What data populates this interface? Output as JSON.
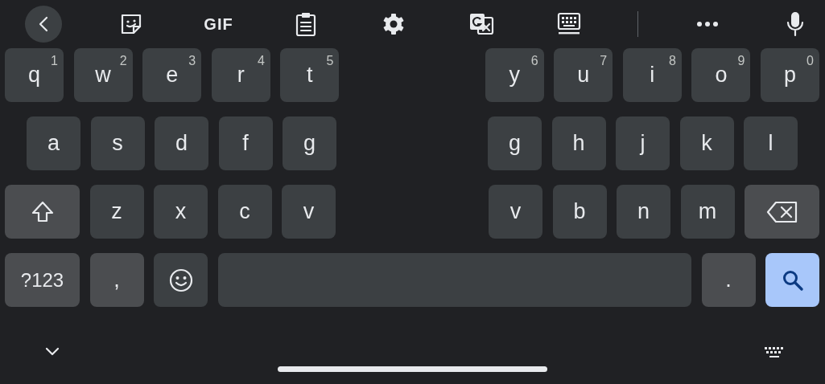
{
  "toolbar": [
    {
      "kind": "back"
    },
    {
      "kind": "sticker"
    },
    {
      "kind": "text",
      "label": "GIF"
    },
    {
      "kind": "clipboard"
    },
    {
      "kind": "settings"
    },
    {
      "kind": "translate"
    },
    {
      "kind": "keyboard"
    },
    {
      "kind": "divider"
    },
    {
      "kind": "more"
    },
    {
      "kind": "mic"
    }
  ],
  "rows": [
    {
      "left": [
        {
          "kind": "letter",
          "label": "q",
          "hint": "1"
        },
        {
          "kind": "letter",
          "label": "w",
          "hint": "2"
        },
        {
          "kind": "letter",
          "label": "e",
          "hint": "3"
        },
        {
          "kind": "letter",
          "label": "r",
          "hint": "4"
        },
        {
          "kind": "letter",
          "label": "t",
          "hint": "5"
        }
      ],
      "right": [
        {
          "kind": "letter",
          "label": "y",
          "hint": "6"
        },
        {
          "kind": "letter",
          "label": "u",
          "hint": "7"
        },
        {
          "kind": "letter",
          "label": "i",
          "hint": "8"
        },
        {
          "kind": "letter",
          "label": "o",
          "hint": "9"
        },
        {
          "kind": "letter",
          "label": "p",
          "hint": "0"
        }
      ]
    },
    {
      "left": [
        {
          "kind": "letter",
          "label": "a"
        },
        {
          "kind": "letter",
          "label": "s"
        },
        {
          "kind": "letter",
          "label": "d"
        },
        {
          "kind": "letter",
          "label": "f"
        },
        {
          "kind": "letter",
          "label": "g"
        }
      ],
      "right": [
        {
          "kind": "letter",
          "label": "g"
        },
        {
          "kind": "letter",
          "label": "h"
        },
        {
          "kind": "letter",
          "label": "j"
        },
        {
          "kind": "letter",
          "label": "k"
        },
        {
          "kind": "letter",
          "label": "l"
        }
      ]
    },
    {
      "left": [
        {
          "kind": "shift"
        },
        {
          "kind": "letter",
          "label": "z"
        },
        {
          "kind": "letter",
          "label": "x"
        },
        {
          "kind": "letter",
          "label": "c"
        },
        {
          "kind": "letter",
          "label": "v"
        }
      ],
      "right": [
        {
          "kind": "letter",
          "label": "v"
        },
        {
          "kind": "letter",
          "label": "b"
        },
        {
          "kind": "letter",
          "label": "n"
        },
        {
          "kind": "letter",
          "label": "m"
        },
        {
          "kind": "backspace"
        }
      ]
    },
    {
      "left": [
        {
          "kind": "symbols",
          "label": "?123"
        },
        {
          "kind": "punct",
          "label": ","
        },
        {
          "kind": "emoji"
        },
        {
          "kind": "space"
        }
      ],
      "right": [
        {
          "kind": "punct",
          "label": "."
        },
        {
          "kind": "search"
        }
      ]
    }
  ],
  "bottom": [
    {
      "kind": "hide"
    },
    {
      "kind": "switch"
    }
  ]
}
